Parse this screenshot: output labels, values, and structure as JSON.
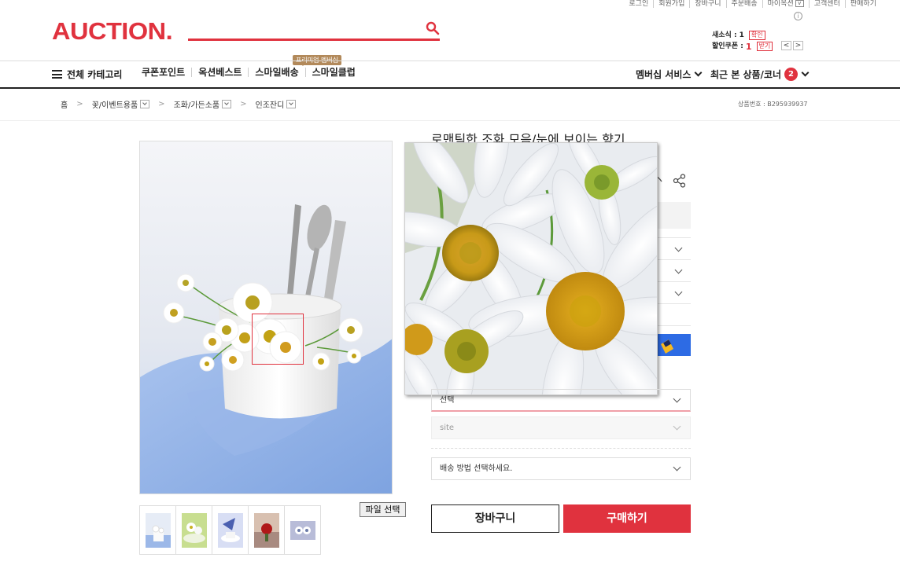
{
  "util_links": [
    "로그인",
    "회원가입",
    "장바구니",
    "주문배송",
    "마이옥션",
    "고객센터",
    "판매하기"
  ],
  "logo": "AUCTION.",
  "coupon": {
    "cash_label": "새소식 :",
    "cash_value": "1",
    "cash_tag": "확인",
    "coupon_label": "할인쿠폰 :",
    "coupon_value": "1",
    "coupon_tag": "받기",
    "prev": "<",
    "next": ">"
  },
  "gnb": {
    "category": "전체 카테고리",
    "links": [
      "쿠폰포인트",
      "옥션베스트",
      "스마일배송",
      "스마일클럽"
    ],
    "premium_tag": "프리미엄 멤버십",
    "membership": "멤버십 서비스",
    "recent": "최근 본 상품/코너",
    "recent_count": "2"
  },
  "breadcrumb": {
    "home": "홈",
    "items": [
      "꽃/이벤트용품",
      "조화/가든소품",
      "인조잔디"
    ]
  },
  "item_no": "상품번호 : B295939937",
  "product": {
    "title": "로맨틱한 조화 모음/눈에 보이는 향기"
  },
  "file_button": "파일 선택",
  "options": {
    "select1": "선택",
    "select2": "site",
    "shipping": "배송 방법 선택하세요."
  },
  "buttons": {
    "cart": "장바구니",
    "buy": "구매하기"
  },
  "colors": {
    "brand": "#e0323e",
    "blue": "#2d6be4"
  }
}
